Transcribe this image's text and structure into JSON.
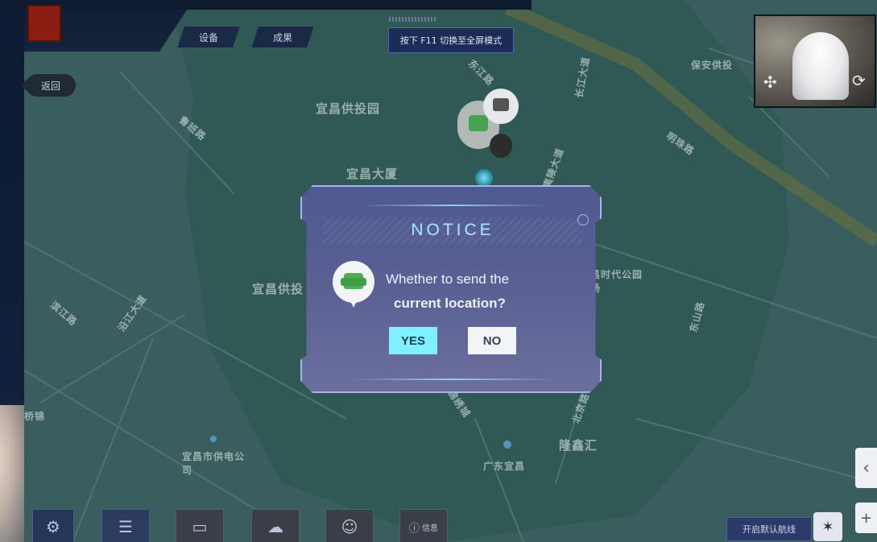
{
  "header": {
    "logo_text": "",
    "tabs": [
      {
        "label": "设备"
      },
      {
        "label": "成果"
      }
    ],
    "back_label": "返回",
    "fullscreen_hint": "按下 F11 切换至全屏模式"
  },
  "map": {
    "labels": [
      {
        "text": "宜昌供投园"
      },
      {
        "text": "宜昌大厦"
      },
      {
        "text": "宜昌供投"
      },
      {
        "text": "鲁班路"
      },
      {
        "text": "滨江路"
      },
      {
        "text": "沿江大道"
      },
      {
        "text": "长江大道"
      },
      {
        "text": "桥锦"
      },
      {
        "text": "东江路"
      },
      {
        "text": "保安供投"
      },
      {
        "text": "明珠路"
      },
      {
        "text": "宜昌时代公园广场"
      },
      {
        "text": "东山路"
      },
      {
        "text": "锦绣城"
      },
      {
        "text": "隆鑫汇"
      },
      {
        "text": "北京路"
      },
      {
        "text": "夷陵大道"
      },
      {
        "text": "宜昌市供电公司"
      },
      {
        "text": "广东宜昌"
      }
    ]
  },
  "dialog": {
    "title": "NOTICE",
    "message_line1": "Whether to send the",
    "message_line2": "current location?",
    "yes_label": "YES",
    "no_label": "NO"
  },
  "toolbar": {
    "items": [
      {
        "icon": "gear-icon"
      },
      {
        "icon": "list-icon"
      },
      {
        "icon": "battery-icon"
      },
      {
        "icon": "weather-icon"
      },
      {
        "icon": "person-icon"
      },
      {
        "icon": "info-icon",
        "label": "信息"
      }
    ],
    "right_button": "开启默认航线",
    "right_icon": "satellite-icon"
  },
  "side_controls": {
    "collapse_glyph": "‹",
    "zoom_glyph": "+"
  },
  "colors": {
    "map_bg": "#3a5e5d",
    "dialog_title": "#a9e8ff",
    "yes_button": "#7ff0ff",
    "no_button": "#f2f4f8"
  }
}
